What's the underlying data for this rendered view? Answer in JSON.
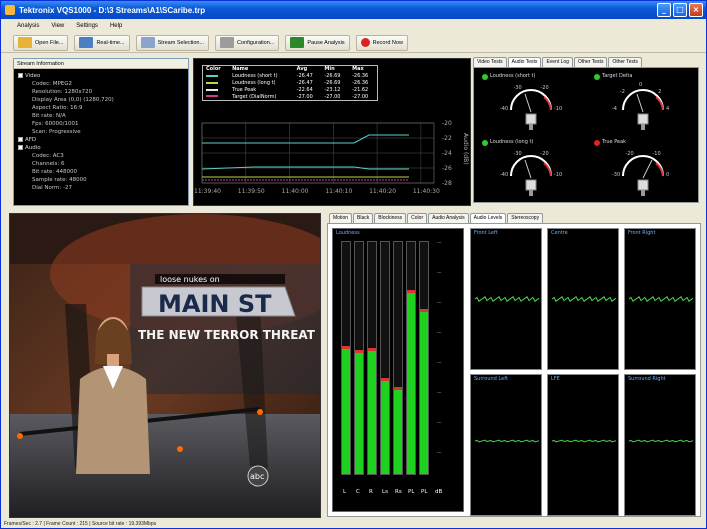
{
  "window": {
    "title": "Tektronix VQS1000 - D:\\3 Streams\\A1\\SCaribe.trp"
  },
  "menu": [
    "Analysis",
    "View",
    "Settings",
    "Help"
  ],
  "toolbar": [
    {
      "label": "Open File...",
      "icon": "folder-icon",
      "color": "#e8b23a"
    },
    {
      "label": "Real-time...",
      "icon": "realtime-icon",
      "color": "#4a7fc1"
    },
    {
      "label": "Stream Selection...",
      "icon": "stream-icon",
      "color": "#8aa4cc"
    },
    {
      "label": "Configuration...",
      "icon": "config-icon",
      "color": "#9c9c9c"
    },
    {
      "label": "Pause Analysis",
      "icon": "pause-icon",
      "color": "#2a8a2a"
    },
    {
      "label": "Record Now",
      "icon": "record-icon",
      "color": "#d22"
    }
  ],
  "stream_info": {
    "header": "Stream Information",
    "tree": [
      {
        "type": "node",
        "label": "Video"
      },
      {
        "type": "leaf",
        "label": "Codec: MPEG2"
      },
      {
        "type": "leaf",
        "label": "Resolution: 1280x720"
      },
      {
        "type": "leaf",
        "label": "Display Area (0,0) (1280,720)"
      },
      {
        "type": "leaf",
        "label": "Aspect Ratio: 16:9"
      },
      {
        "type": "leaf",
        "label": "Bit rate: N/A"
      },
      {
        "type": "leaf",
        "label": "Fps: 60000/1001"
      },
      {
        "type": "leaf",
        "label": "Scan: Progressive"
      },
      {
        "type": "node",
        "label": "AFD"
      },
      {
        "type": "node",
        "label": "Audio"
      },
      {
        "type": "leaf",
        "label": "Codec: AC3"
      },
      {
        "type": "leaf",
        "label": "Channels: 6"
      },
      {
        "type": "leaf",
        "label": "Bit rate: 448000"
      },
      {
        "type": "leaf",
        "label": "Sample rate: 48000"
      },
      {
        "type": "leaf",
        "label": "Dial Norm: -27"
      }
    ]
  },
  "loudness_graph": {
    "headers": [
      "Color",
      "Name",
      "Avg",
      "Min",
      "Max"
    ],
    "rows": [
      {
        "color": "#5ad0c8",
        "name": "Loudness (short t)",
        "avg": "-26.47",
        "min": "-26.69",
        "max": "-26.36"
      },
      {
        "color": "#b8d84a",
        "name": "Loudness (long t)",
        "avg": "-26.47",
        "min": "-26.69",
        "max": "-26.36"
      },
      {
        "color": "#e8e8e8",
        "name": "True Peak",
        "avg": "-22.64",
        "min": "-23.12",
        "max": "-21.62"
      },
      {
        "color": "#d43a8a",
        "name": "Target (DialNorm)",
        "avg": "-27.00",
        "min": "-27.00",
        "max": "-27.00"
      }
    ],
    "y_axis_label": "Audio (dB)",
    "y_ticks": [
      "-20",
      "-22",
      "-24",
      "-26",
      "-28"
    ],
    "x_ticks": [
      "11:39:40",
      "11:39:50",
      "11:40:00",
      "11:40:10",
      "11:40:20",
      "11:40:30"
    ]
  },
  "right_tabs": [
    "Video Tests",
    "Audio Tests",
    "Event Log",
    "Other Tests",
    "Other Tests"
  ],
  "right_active_tab": 1,
  "dials": [
    {
      "label": "Loudness (short t)",
      "led": "#2ecc2e",
      "scale": [
        "-40",
        "-30",
        "-20",
        "-10"
      ]
    },
    {
      "label": "Target Delta",
      "led": "#2ecc2e",
      "scale": [
        "-4",
        "-2",
        "0",
        "2",
        "4"
      ]
    },
    {
      "label": "Loudness (long t)",
      "led": "#2ecc2e",
      "scale": [
        "-40",
        "-30",
        "-20",
        "-10"
      ]
    },
    {
      "label": "True Peak",
      "led": "#dd2222",
      "scale": [
        "-30",
        "-20",
        "-10",
        "0"
      ]
    }
  ],
  "video": {
    "banner_top": "loose nukes on",
    "banner_main": "MAIN ST",
    "banner_sub": "THE NEW TERROR THREAT",
    "network": "abc"
  },
  "levels_tabs": [
    "Motion",
    "Black",
    "Blockiness",
    "Color",
    "Audio Analysis",
    "Audio Levels",
    "Stereoscopy"
  ],
  "levels_active_tab": 5,
  "loudness_meter": {
    "title": "Loudness",
    "channels": [
      {
        "label": "L",
        "level": 0.54
      },
      {
        "label": "C",
        "level": 0.52
      },
      {
        "label": "R",
        "level": 0.53
      },
      {
        "label": "Ls",
        "level": 0.4
      },
      {
        "label": "Rs",
        "level": 0.36
      },
      {
        "label": "PL",
        "level": 0.78
      },
      {
        "label": "PL",
        "level": 0.7
      }
    ],
    "extra_label": "dB"
  },
  "scopes": [
    {
      "title": "Front Left"
    },
    {
      "title": "Centre"
    },
    {
      "title": "Front Right"
    },
    {
      "title": "Surround Left"
    },
    {
      "title": "LFE"
    },
    {
      "title": "Surround Right"
    }
  ],
  "status": "Frames/Sec : 2.7 | Frame Count : 215 | Source bit rate : 19.393Mbps"
}
